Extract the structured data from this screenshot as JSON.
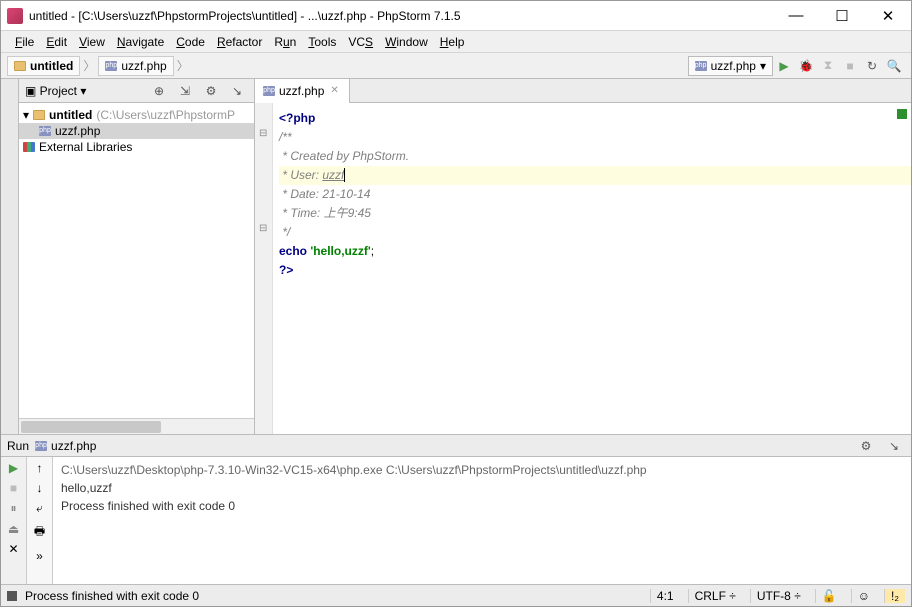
{
  "title": "untitled - [C:\\Users\\uzzf\\PhpstormProjects\\untitled] - ...\\uzzf.php - PhpStorm 7.1.5",
  "menu": {
    "file": "File",
    "edit": "Edit",
    "view": "View",
    "nav": "Navigate",
    "code": "Code",
    "refactor": "Refactor",
    "run": "Run",
    "tools": "Tools",
    "vcs": "VCS",
    "window": "Window",
    "help": "Help"
  },
  "crumbs": {
    "root": "untitled",
    "file": "uzzf.php"
  },
  "runcfg": "uzzf.php",
  "project": {
    "label": "Project",
    "root": "untitled",
    "rootpath": "(C:\\Users\\uzzf\\PhpstormP",
    "file": "uzzf.php",
    "extlib": "External Libraries"
  },
  "tab": "uzzf.php",
  "code": {
    "l1": "<?php",
    "l2": "/**",
    "l3": " * Created by PhpStorm.",
    "l4a": " * User: ",
    "l4b": "uzzf",
    "l5": " * Date: 21-10-14",
    "l6": " * Time: 上午9:45",
    "l7": " */",
    "l8a": "echo ",
    "l8b": "'hello,uzzf'",
    "l8c": ";",
    "l9": "?>"
  },
  "console": {
    "run": "Run",
    "file": "uzzf.php",
    "cmd": "C:\\Users\\uzzf\\Desktop\\php-7.3.10-Win32-VC15-x64\\php.exe C:\\Users\\uzzf\\PhpstormProjects\\untitled\\uzzf.php",
    "out": "hello,uzzf",
    "exit": "Process finished with exit code 0"
  },
  "status": {
    "msg": "Process finished with exit code 0",
    "pos": "4:1",
    "eol": "CRLF",
    "enc": "UTF-8"
  }
}
